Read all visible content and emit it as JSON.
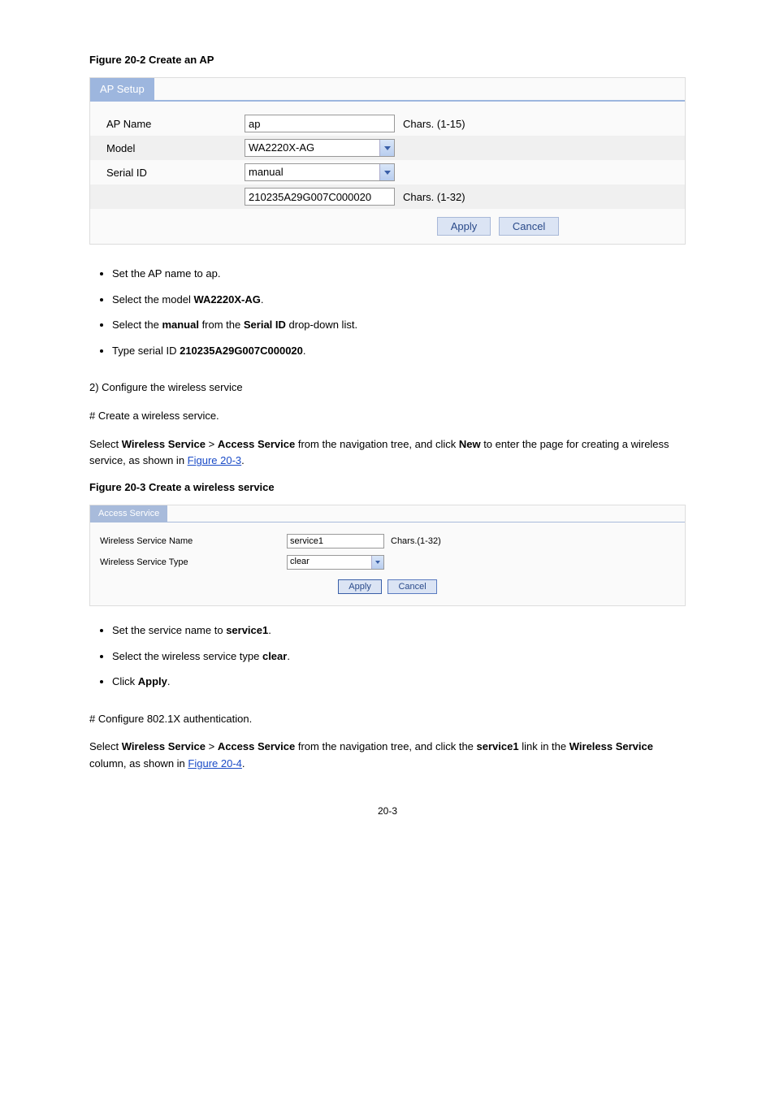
{
  "fig1": {
    "caption": "Figure 20-2 Create an AP",
    "tab_title": "AP Setup",
    "rows": {
      "ap_name_label": "AP Name",
      "ap_name_value": "ap",
      "ap_name_hint": "Chars. (1-15)",
      "model_label": "Model",
      "model_value": "WA2220X-AG",
      "serial_label": "Serial ID",
      "serial_mode": "manual",
      "serial_value": "210235A29G007C000020",
      "serial_hint": "Chars. (1-32)"
    },
    "apply": "Apply",
    "cancel": "Cancel"
  },
  "bullets1": [
    "Set the AP name to ap.",
    "Select the model WA2220X-AG.",
    "Select the manual from the Serial ID drop-down list.",
    "Type serial ID 210235A29G007C000020."
  ],
  "step2": {
    "heading": "2)  Configure the wireless service",
    "number": "# Create a wireless service.",
    "nav": [
      "Select ",
      "Wireless Service",
      " > ",
      "Access Service",
      " from the navigation tree, and click ",
      "New",
      " to enter the page for creating a wireless service, as shown in ",
      "Figure 20-3",
      "."
    ]
  },
  "fig2": {
    "caption": "Figure 20-3 Create a wireless service",
    "tab_title": "Access Service",
    "rows": {
      "name_label": "Wireless Service Name",
      "name_value": "service1",
      "name_hint": "Chars.(1-32)",
      "type_label": "Wireless Service Type",
      "type_value": "clear"
    },
    "apply": "Apply",
    "cancel": "Cancel"
  },
  "bullets2": [
    "Set the service name to service1.",
    "Select the wireless service type clear.",
    "Click Apply."
  ],
  "step3": {
    "number": "# Configure 802.1X authentication.",
    "nav": [
      "Select ",
      "Wireless Service",
      " > ",
      "Access Service",
      " from the navigation tree, and click the ",
      "service1",
      " link in the ",
      "Wireless Service",
      " column, as shown in ",
      "Figure 20-4",
      "."
    ]
  },
  "page_number": "20-3"
}
